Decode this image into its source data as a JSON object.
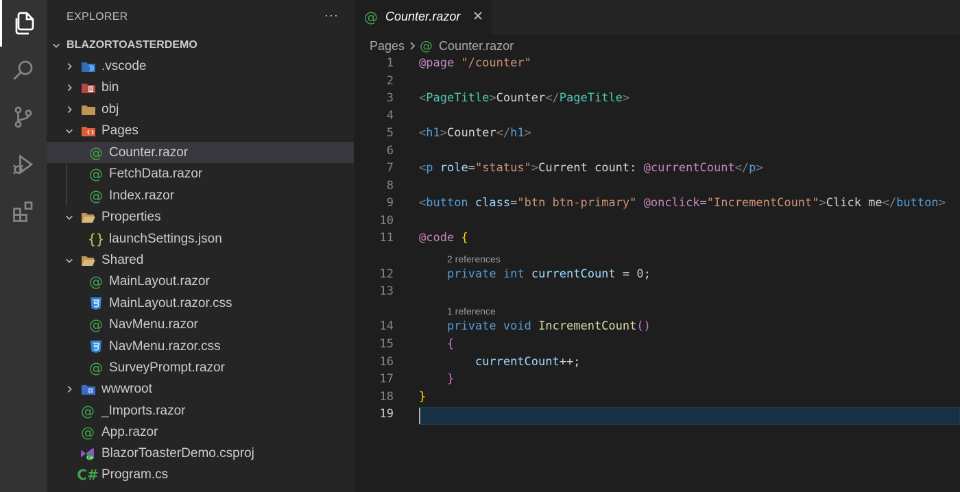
{
  "sidebar": {
    "title": "EXPLORER",
    "more_label": "···",
    "root": "BLAZORTOASTERDEMO",
    "items": [
      {
        "label": ".vscode",
        "icon": "vscode-folder-icon",
        "type": "folder",
        "state": "collapsed"
      },
      {
        "label": "bin",
        "icon": "bin-folder-icon",
        "type": "folder",
        "state": "collapsed"
      },
      {
        "label": "obj",
        "icon": "folder-icon",
        "type": "folder",
        "state": "collapsed"
      },
      {
        "label": "Pages",
        "icon": "pages-folder-icon",
        "type": "folder",
        "state": "expanded"
      },
      {
        "label": "Counter.razor",
        "icon": "razor-file-icon",
        "type": "file",
        "selected": true
      },
      {
        "label": "FetchData.razor",
        "icon": "razor-file-icon",
        "type": "file"
      },
      {
        "label": "Index.razor",
        "icon": "razor-file-icon",
        "type": "file"
      },
      {
        "label": "Properties",
        "icon": "open-folder-icon",
        "type": "folder",
        "state": "expanded"
      },
      {
        "label": "launchSettings.json",
        "icon": "json-file-icon",
        "type": "file"
      },
      {
        "label": "Shared",
        "icon": "open-folder-icon",
        "type": "folder",
        "state": "expanded"
      },
      {
        "label": "MainLayout.razor",
        "icon": "razor-file-icon",
        "type": "file"
      },
      {
        "label": "MainLayout.razor.css",
        "icon": "css-file-icon",
        "type": "file"
      },
      {
        "label": "NavMenu.razor",
        "icon": "razor-file-icon",
        "type": "file"
      },
      {
        "label": "NavMenu.razor.css",
        "icon": "css-file-icon",
        "type": "file"
      },
      {
        "label": "SurveyPrompt.razor",
        "icon": "razor-file-icon",
        "type": "file"
      },
      {
        "label": "wwwroot",
        "icon": "www-folder-icon",
        "type": "folder",
        "state": "collapsed"
      },
      {
        "label": "_Imports.razor",
        "icon": "razor-file-icon",
        "type": "file"
      },
      {
        "label": "App.razor",
        "icon": "razor-file-icon",
        "type": "file"
      },
      {
        "label": "BlazorToasterDemo.csproj",
        "icon": "csproj-file-icon",
        "type": "file"
      },
      {
        "label": "Program.cs",
        "icon": "csharp-file-icon",
        "type": "file"
      }
    ]
  },
  "tab": {
    "label": "Counter.razor"
  },
  "breadcrumb": {
    "folder": "Pages",
    "file": "Counter.razor"
  },
  "editor": {
    "line_numbers": [
      "1",
      "2",
      "3",
      "4",
      "5",
      "6",
      "7",
      "8",
      "9",
      "10",
      "11",
      "12",
      "13",
      "14",
      "15",
      "16",
      "17",
      "18",
      "19"
    ],
    "current_line": "19",
    "codelens": [
      "2 references",
      "1 reference"
    ],
    "code": {
      "l1": [
        "@page",
        " ",
        "\"/counter\""
      ],
      "l3": [
        "<",
        "PageTitle",
        ">",
        "Counter",
        "</",
        "PageTitle",
        ">"
      ],
      "l5": [
        "<",
        "h1",
        ">",
        "Counter",
        "</",
        "h1",
        ">"
      ],
      "l7": [
        "<",
        "p",
        " ",
        "role",
        "=",
        "\"status\"",
        ">",
        "Current count: ",
        "@currentCount",
        "</",
        "p",
        ">"
      ],
      "l9": [
        "<",
        "button",
        " ",
        "class",
        "=",
        "\"btn btn-primary\"",
        " ",
        "@onclick",
        "=",
        "\"IncrementCount\"",
        ">",
        "Click me",
        "</",
        "button",
        ">"
      ],
      "l11": [
        "@code",
        " ",
        "{"
      ],
      "l12": [
        "    ",
        "private",
        " ",
        "int",
        " ",
        "currentCount",
        " = ",
        "0",
        ";"
      ],
      "l14": [
        "    ",
        "private",
        " ",
        "void",
        " ",
        "IncrementCount",
        "()"
      ],
      "l15": [
        "    ",
        "{"
      ],
      "l16": [
        "        ",
        "currentCount",
        "++;"
      ],
      "l17": [
        "    ",
        "}"
      ],
      "l18": [
        "}"
      ]
    }
  },
  "colors": {
    "razor_at": "#3fa64b",
    "keyword": "#569cd6",
    "string": "#ce9178",
    "variable": "#9cdcfe",
    "function": "#dcdcaa",
    "component": "#4ec9b0",
    "directive": "#c586c0"
  }
}
